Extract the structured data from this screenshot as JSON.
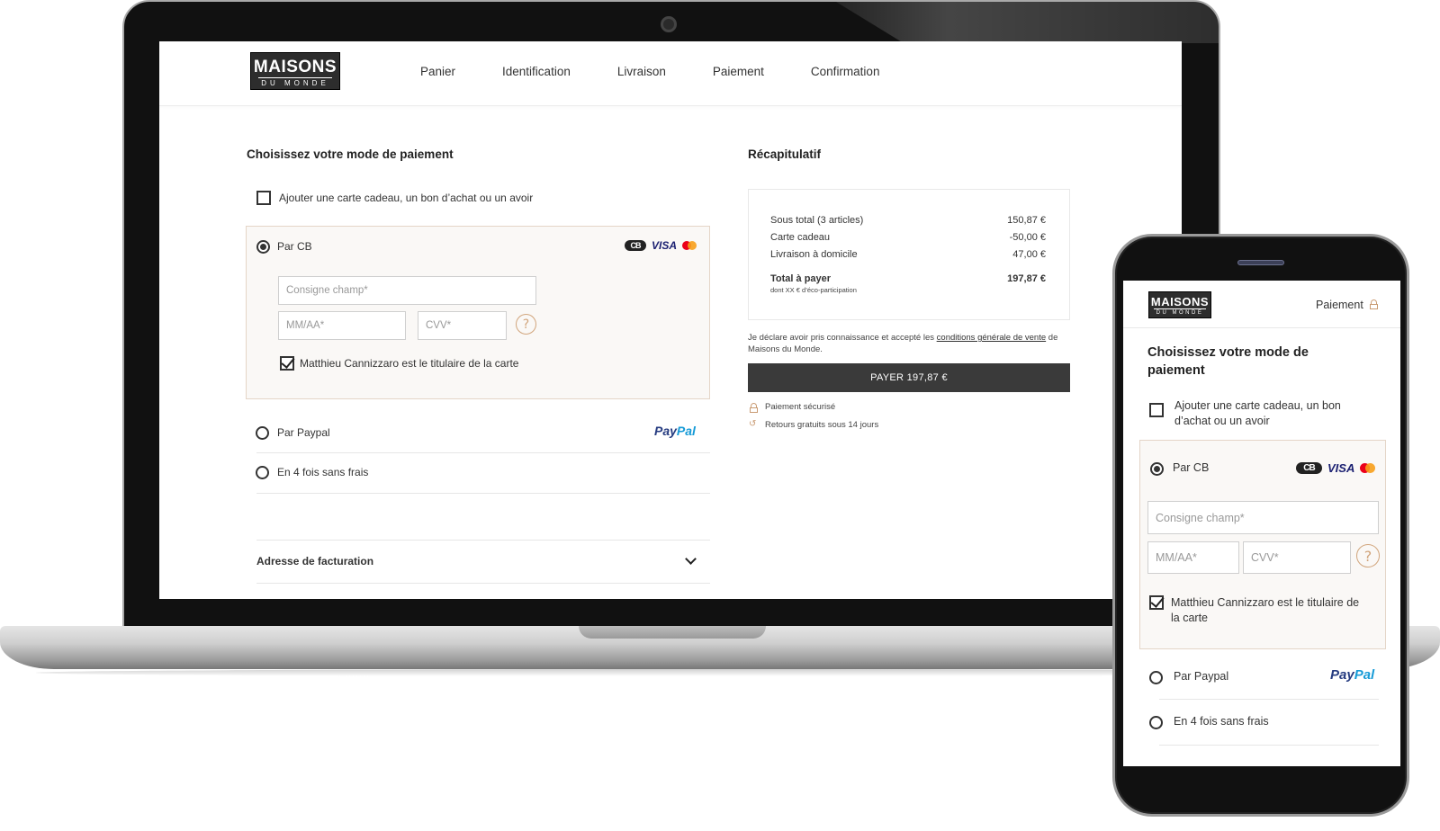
{
  "brand": {
    "name_line1": "MAISONS",
    "name_line2": "DU MONDE"
  },
  "colors": {
    "accent": "#d1a57c",
    "panel_bg": "#faf8f6",
    "button_bg": "#3a3a3a",
    "visa": "#1a1f71",
    "paypal_dark": "#253b80",
    "paypal_light": "#179bd7"
  },
  "desktop": {
    "nav": [
      "Panier",
      "Identification",
      "Livraison",
      "Paiement",
      "Confirmation"
    ],
    "title": "Choisissez votre mode de paiement",
    "gift_checkbox_label": "Ajouter une carte cadeau, un bon d’achat ou un avoir",
    "cb": {
      "label": "Par CB",
      "placeholder_name": "Consigne champ*",
      "placeholder_date": "MM/AA*",
      "placeholder_cvv": "CVV*",
      "holder_label": "Matthieu Cannizzaro est le titulaire de la carte",
      "help_glyph": "?",
      "card_logos": [
        "CB",
        "VISA",
        "mastercard"
      ]
    },
    "paypal": {
      "label": "Par Paypal",
      "logo_pay": "Pay",
      "logo_pal": "Pal"
    },
    "four_times": {
      "label": "En 4 fois sans frais"
    },
    "billing": {
      "label": "Adresse de facturation"
    },
    "recap": {
      "title": "Récapitulatif",
      "rows": [
        {
          "label": "Sous total (3 articles)",
          "value": "150,87  €"
        },
        {
          "label": "Carte cadeau",
          "value": "-50,00 €"
        },
        {
          "label": "Livraison à domicile",
          "value": "47,00 €"
        }
      ],
      "total_label": "Total à payer",
      "total_value": "197,87 €",
      "eco_note": "dont XX € d’éco-participation",
      "legal_prefix": "Je déclare avoir pris connaissance et accepté les",
      "legal_link": "conditions générale de vente",
      "legal_suffix": "de",
      "legal_line2": "Maisons du Monde.",
      "pay_button": "PAYER 197,87 €",
      "secure": "Paiement sécurisé",
      "returns": "Retours gratuits sous 14 jours"
    }
  },
  "mobile": {
    "step": "Paiement",
    "title_line1": "Choisissez votre mode de",
    "title_line2": "paiement",
    "gift_line1": "Ajouter une carte cadeau, un bon",
    "gift_line2": "d’achat ou un avoir",
    "cb_label": "Par CB",
    "placeholder_name": "Consigne champ*",
    "placeholder_date": "MM/AA*",
    "placeholder_cvv": "CVV*",
    "holder_line1": "Matthieu Cannizzaro est le titulaire de",
    "holder_line2": "la carte",
    "paypal_label": "Par Paypal",
    "four_times_label": "En 4 fois sans frais"
  }
}
